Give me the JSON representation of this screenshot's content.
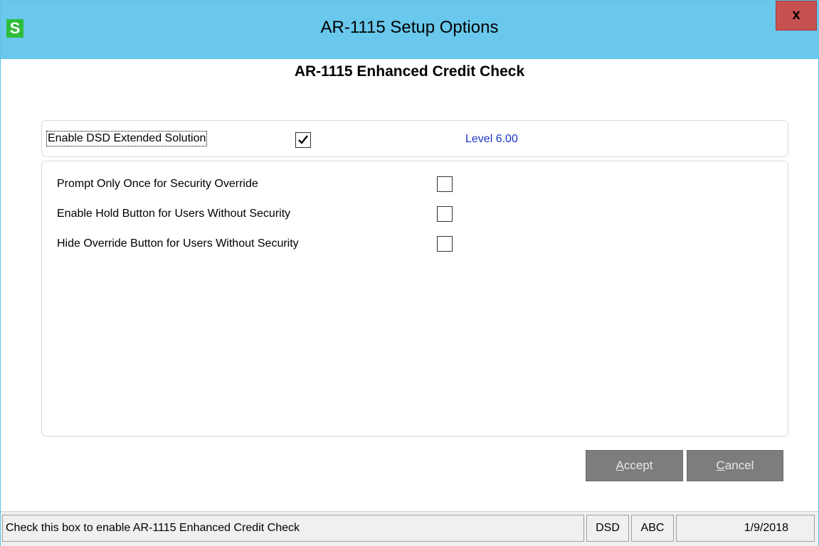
{
  "window": {
    "app_icon": "S",
    "title": "AR-1115 Setup Options",
    "close_label": "x"
  },
  "dialog": {
    "heading": "AR-1115 Enhanced Credit Check"
  },
  "enable_section": {
    "label": "Enable DSD Extended Solution",
    "checked": true,
    "level_text": "Level  6.00"
  },
  "options": [
    {
      "label": "Prompt Only Once for Security Override",
      "checked": false
    },
    {
      "label": "Enable Hold Button for Users Without Security",
      "checked": false
    },
    {
      "label": "Hide Override Button for Users Without Security",
      "checked": false
    }
  ],
  "buttons": {
    "accept_mnemonic": "A",
    "accept_rest": "ccept",
    "cancel_mnemonic": "C",
    "cancel_rest": "ancel"
  },
  "status_bar": {
    "message": "Check this box to enable AR-1115 Enhanced Credit Check",
    "company_code": "DSD",
    "user_code": "ABC",
    "date": "1/9/2018"
  },
  "colors": {
    "titlebar": "#69c8ec",
    "close_button": "#c75050",
    "level_text": "#1a35c7",
    "button_bg": "#7d7d7d",
    "app_icon_bg": "#2ebd3b"
  },
  "icons": {
    "app": "sage-s-icon",
    "checkmark": "checkmark-icon"
  }
}
